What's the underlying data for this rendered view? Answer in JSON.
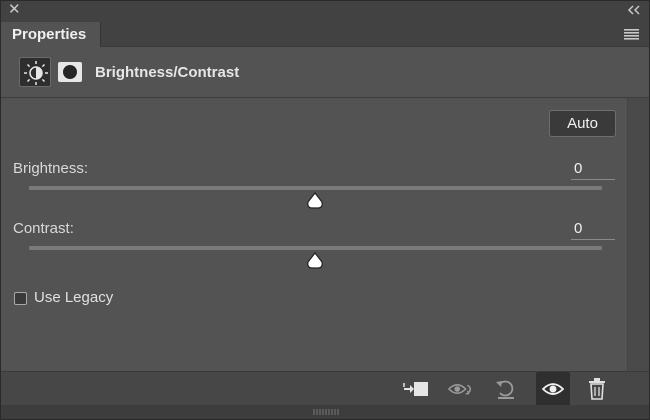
{
  "panel": {
    "tab_label": "Properties",
    "header_title": "Brightness/Contrast",
    "auto_label": "Auto",
    "brightness": {
      "label": "Brightness:",
      "value": "0"
    },
    "contrast": {
      "label": "Contrast:",
      "value": "0"
    },
    "legacy": {
      "label": "Use Legacy",
      "checked": false
    }
  },
  "icons": {
    "close": "close-icon",
    "collapse": "collapse-icon",
    "menu": "panel-menu-icon",
    "adjustment": "brightness-contrast-icon",
    "mask": "mask-icon",
    "clip": "clip-to-layer-icon",
    "view_previous": "view-previous-state-icon",
    "reset": "reset-icon",
    "visibility": "eye-icon",
    "delete": "trash-icon"
  }
}
